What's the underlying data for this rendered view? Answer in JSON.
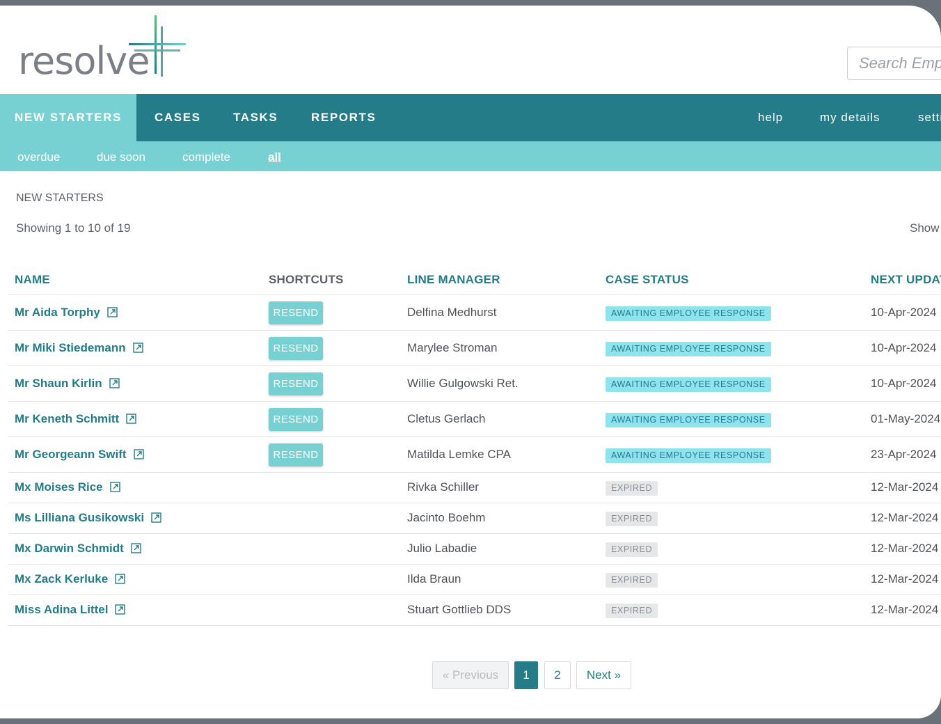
{
  "brand": {
    "logo_text": "resolve",
    "accent": "#237c87",
    "light_accent": "#77d0d2",
    "logo_green": "#5bbf7a"
  },
  "search": {
    "placeholder": "Search Employees"
  },
  "main_nav": {
    "items": [
      "NEW STARTERS",
      "CASES",
      "TASKS",
      "REPORTS"
    ],
    "active": "NEW STARTERS",
    "right_items": [
      "help",
      "my details",
      "settings"
    ]
  },
  "sub_nav": {
    "items": [
      "overdue",
      "due soon",
      "complete",
      "all"
    ],
    "active": "all"
  },
  "page": {
    "heading": "NEW STARTERS",
    "showing": "Showing 1 to 10 of 19",
    "show_entries_label": "Show"
  },
  "table": {
    "columns": [
      "NAME",
      "SHORTCUTS",
      "LINE MANAGER",
      "CASE STATUS",
      "NEXT UPDATE"
    ],
    "rows": [
      {
        "name": "Mr Aida Torphy",
        "shortcut": "RESEND",
        "manager": "Delfina Medhurst",
        "status": "AWAITING EMPLOYEE RESPONSE",
        "next_update": "10-Apr-2024"
      },
      {
        "name": "Mr Miki Stiedemann",
        "shortcut": "RESEND",
        "manager": "Marylee Stroman",
        "status": "AWAITING EMPLOYEE RESPONSE",
        "next_update": "10-Apr-2024"
      },
      {
        "name": "Mr Shaun Kirlin",
        "shortcut": "RESEND",
        "manager": "Willie Gulgowski Ret.",
        "status": "AWAITING EMPLOYEE RESPONSE",
        "next_update": "10-Apr-2024"
      },
      {
        "name": "Mr Keneth Schmitt",
        "shortcut": "RESEND",
        "manager": "Cletus Gerlach",
        "status": "AWAITING EMPLOYEE RESPONSE",
        "next_update": "01-May-2024"
      },
      {
        "name": "Mr Georgeann Swift",
        "shortcut": "RESEND",
        "manager": "Matilda Lemke CPA",
        "status": "AWAITING EMPLOYEE RESPONSE",
        "next_update": "23-Apr-2024"
      },
      {
        "name": "Mx Moises Rice",
        "shortcut": "",
        "manager": "Rivka Schiller",
        "status": "EXPIRED",
        "next_update": "12-Mar-2024"
      },
      {
        "name": "Ms Lilliana Gusikowski",
        "shortcut": "",
        "manager": "Jacinto Boehm",
        "status": "EXPIRED",
        "next_update": "12-Mar-2024"
      },
      {
        "name": "Mx Darwin Schmidt",
        "shortcut": "",
        "manager": "Julio Labadie",
        "status": "EXPIRED",
        "next_update": "12-Mar-2024"
      },
      {
        "name": "Mx Zack Kerluke",
        "shortcut": "",
        "manager": "Ilda Braun",
        "status": "EXPIRED",
        "next_update": "12-Mar-2024"
      },
      {
        "name": "Miss Adina Littel",
        "shortcut": "",
        "manager": "Stuart Gottlieb DDS",
        "status": "EXPIRED",
        "next_update": "12-Mar-2024"
      }
    ]
  },
  "pagination": {
    "previous": "« Previous",
    "pages": [
      "1",
      "2"
    ],
    "current": "1",
    "next": "Next »"
  },
  "icons": {
    "name_link": "external-link-icon"
  }
}
